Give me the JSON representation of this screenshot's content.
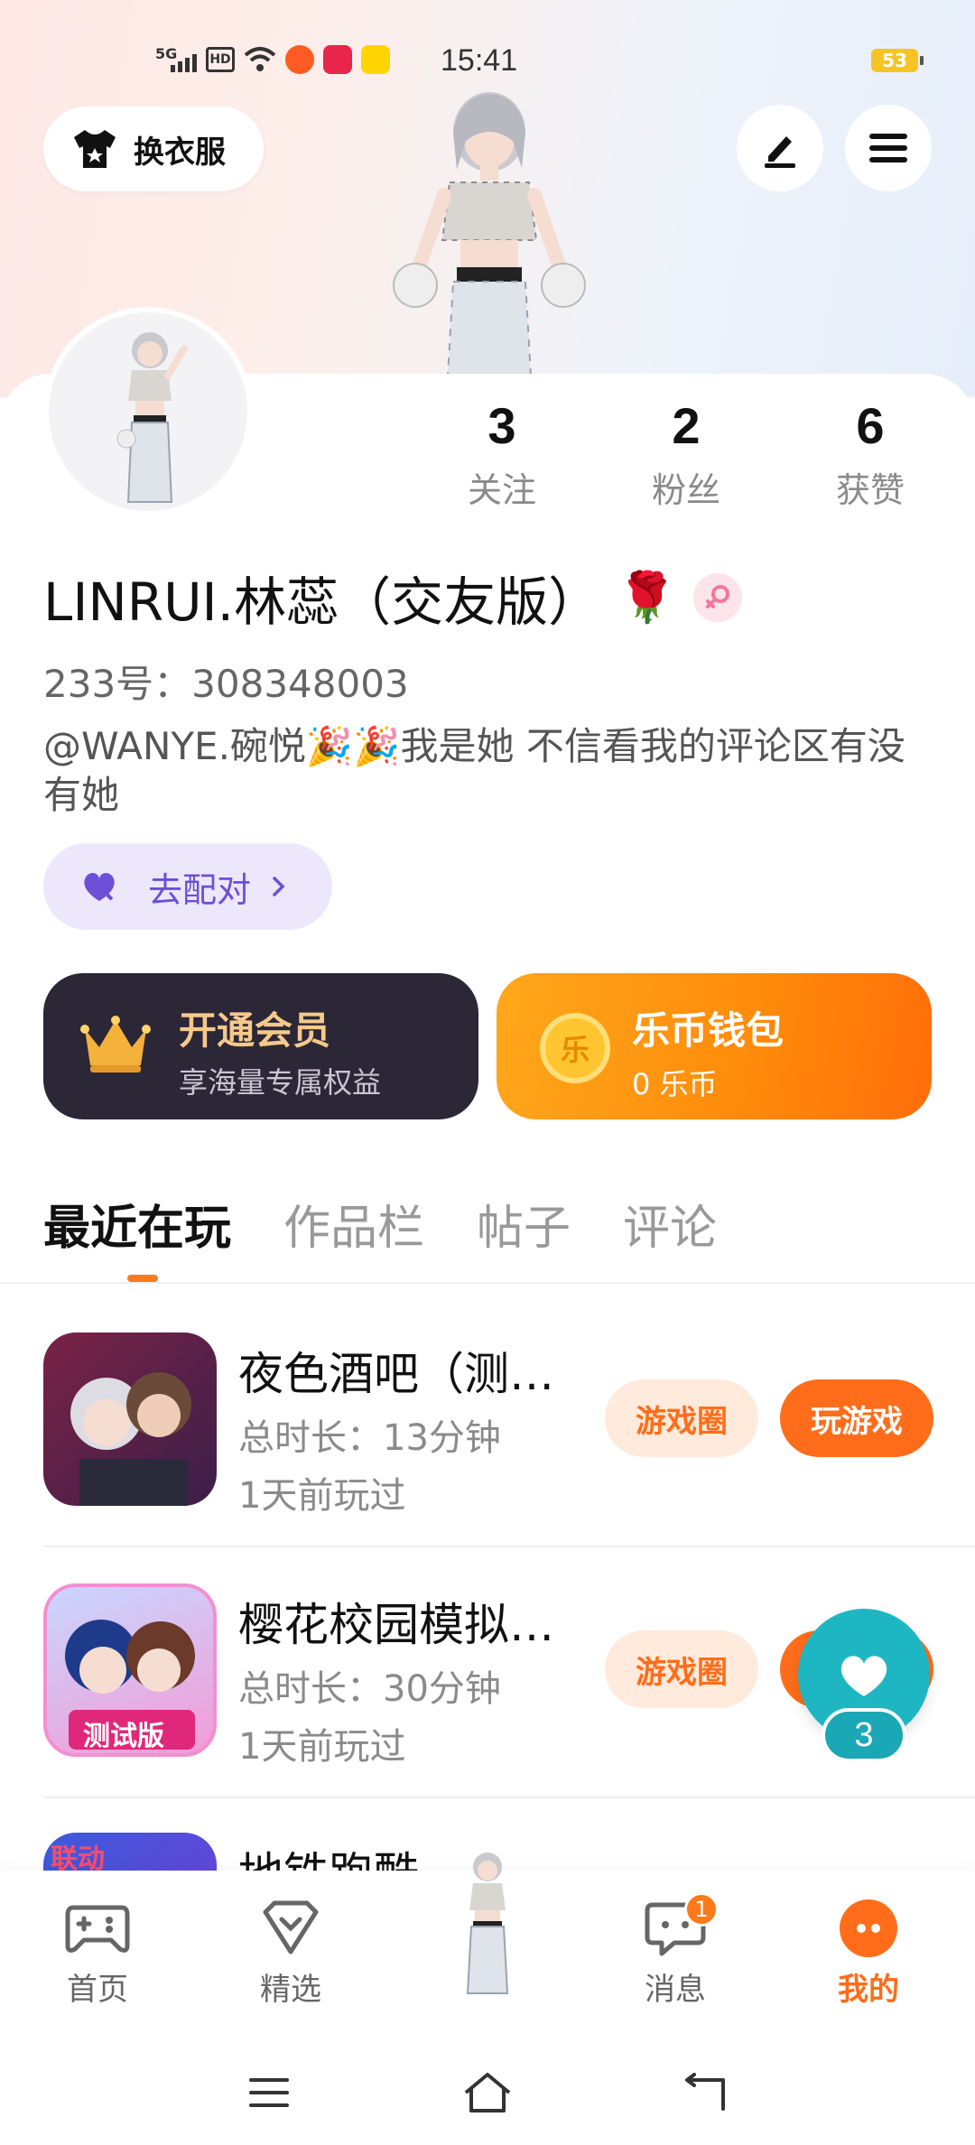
{
  "status_bar": {
    "time": "15:41",
    "network": "5G",
    "hd": "HD",
    "battery": "53"
  },
  "header": {
    "outfit_label": "换衣服",
    "edit_icon": "pen-icon",
    "menu_icon": "hamburger-menu-icon"
  },
  "profile": {
    "stats": [
      {
        "value": "3",
        "label": "关注"
      },
      {
        "value": "2",
        "label": "粉丝"
      },
      {
        "value": "6",
        "label": "获赞"
      }
    ],
    "nickname": "LINRUI.林蕊（交友版）",
    "nickname_emoji": "🌹",
    "gender_icon": "female-icon",
    "uid": "233号：308348003",
    "bio": "@WANYE.碗悦🎉🎉我是她  不信看我的评论区有没有她",
    "pair_button": "去配对"
  },
  "cards": {
    "vip": {
      "title": "开通会员",
      "subtitle": "享海量专属权益"
    },
    "coins": {
      "title": "乐币钱包",
      "subtitle": "0 乐币",
      "coin_glyph": "乐"
    }
  },
  "tabs": [
    {
      "label": "最近在玩",
      "active": true
    },
    {
      "label": "作品栏",
      "active": false
    },
    {
      "label": "帖子",
      "active": false
    },
    {
      "label": "评论",
      "active": false
    }
  ],
  "games": [
    {
      "name": "夜色酒吧（测…",
      "duration": "总时长：13分钟",
      "last_played": "1天前玩过",
      "circle_label": "游戏圈",
      "play_label": "玩游戏"
    },
    {
      "name": "樱花校园模拟…",
      "duration": "总时长：30分钟",
      "last_played": "1天前玩过",
      "circle_label": "游戏圈",
      "play_label": "玩游戏",
      "icon_tag": "测试版"
    },
    {
      "name": "地铁跑酷",
      "icon_tag": "联动"
    }
  ],
  "floating_like": {
    "count": "3"
  },
  "bottom_nav": [
    {
      "label": "首页",
      "icon": "gamepad-icon",
      "active": false
    },
    {
      "label": "精选",
      "icon": "heart-shield-icon",
      "active": false
    },
    {
      "label": "消息",
      "icon": "message-icon",
      "active": false,
      "badge": "1"
    },
    {
      "label": "我的",
      "icon": "profile-face-icon",
      "active": true
    }
  ],
  "colors": {
    "accent": "#ff6d1a",
    "pair_purple": "#6c4fd6",
    "teal": "#1fb6c4",
    "vip_gold": "#f6c98b"
  }
}
